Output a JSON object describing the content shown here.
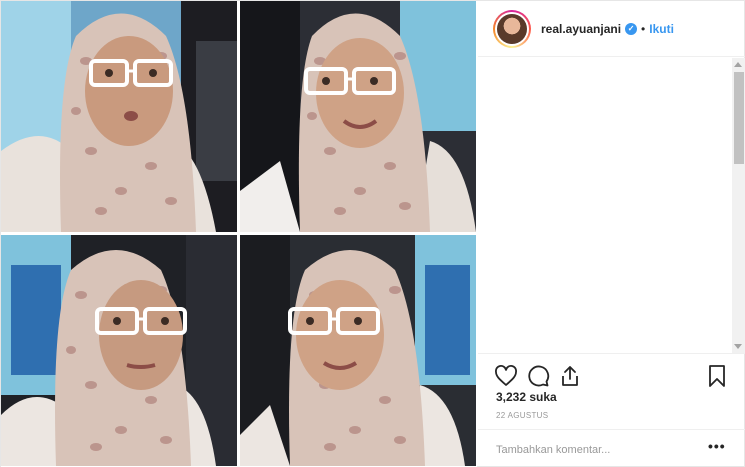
{
  "header": {
    "username": "real.ayuanjani",
    "separator": "•",
    "follow_label": "Ikuti"
  },
  "media": {
    "tiles": [
      {
        "name": "photo-top-left"
      },
      {
        "name": "photo-top-right"
      },
      {
        "name": "photo-bottom-left"
      },
      {
        "name": "photo-bottom-right"
      }
    ]
  },
  "actions": {
    "icons": [
      "heart-icon",
      "comment-icon",
      "share-icon",
      "bookmark-icon"
    ]
  },
  "likes": "3,232 suka",
  "date": "22 AGUSTUS",
  "comment_box": {
    "placeholder": "Tambahkan komentar...",
    "more_label": "•••"
  },
  "colors": {
    "link_blue": "#3897f0",
    "text": "#262626",
    "muted": "#999999",
    "border": "#efefef"
  }
}
